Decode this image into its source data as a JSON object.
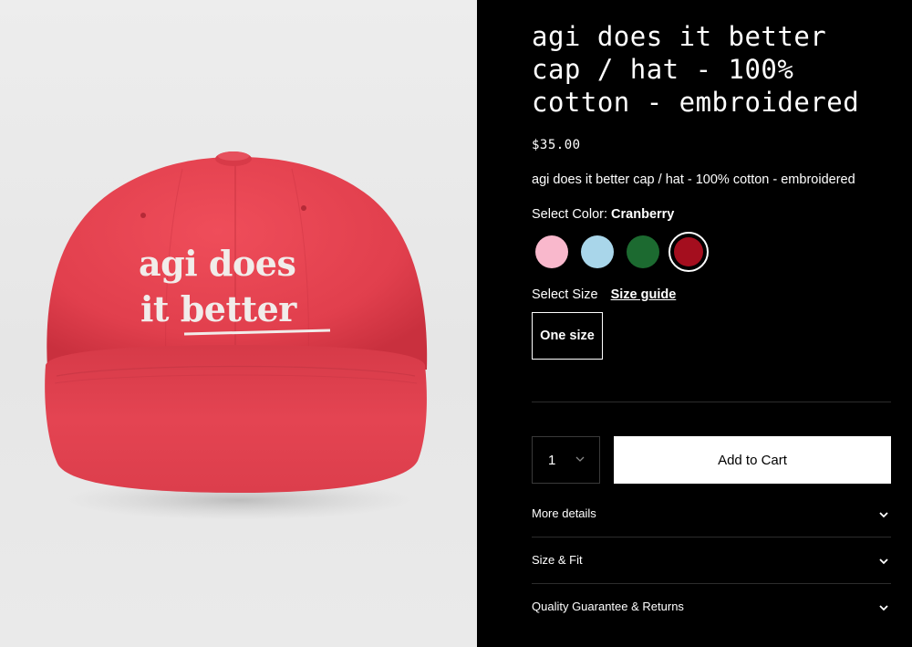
{
  "product": {
    "title_lines": [
      "agi does it better",
      "cap / hat - 100%",
      "cotton - embroidered"
    ],
    "price": "$35.00",
    "description": "agi does it better cap / hat - 100% cotton - embroidered",
    "image_text": {
      "line1": "agi does",
      "line2a": "it ",
      "line2b": "better"
    }
  },
  "color": {
    "label": "Select Color:",
    "selected_name": "Cranberry",
    "swatches": [
      {
        "name": "pink",
        "hex": "#f9b8cc"
      },
      {
        "name": "light-blue",
        "hex": "#a9d6ea"
      },
      {
        "name": "green",
        "hex": "#1c6a30"
      },
      {
        "name": "cranberry",
        "hex": "#a40e1e"
      }
    ]
  },
  "size": {
    "label": "Select Size",
    "guide_label": "Size guide",
    "option": "One size"
  },
  "cart": {
    "quantity": "1",
    "add_label": "Add to Cart"
  },
  "accordions": [
    {
      "label": "More details"
    },
    {
      "label": "Size & Fit"
    },
    {
      "label": "Quality Guarantee & Returns"
    }
  ],
  "colors": {
    "cap": "#e8404e",
    "background": "#000000",
    "text": "#ffffff"
  }
}
